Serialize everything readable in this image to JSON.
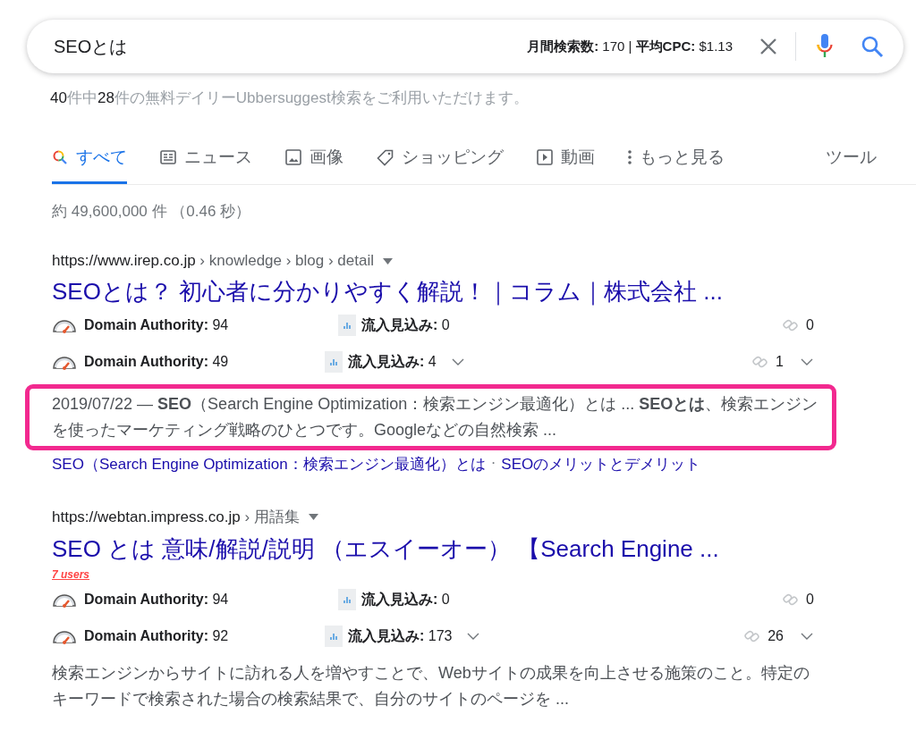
{
  "search": {
    "query": "SEOとは",
    "stats": "**月間検索数:** 170 | **平均CPC:** $1.13"
  },
  "quota": [
    {
      "text": "40",
      "emphasis": true
    },
    {
      "text": "件中",
      "emphasis": false
    },
    {
      "text": "28",
      "emphasis": true
    },
    {
      "text": "件の無料デイリーUbbersuggest検索をご利用いただけます。",
      "emphasis": false
    }
  ],
  "tabs": [
    {
      "label": "すべて",
      "kind": "search",
      "selected": true
    },
    {
      "label": "ニュース",
      "kind": "news",
      "selected": false
    },
    {
      "label": "画像",
      "kind": "image",
      "selected": false
    },
    {
      "label": "ショッピング",
      "kind": "tag",
      "selected": false
    },
    {
      "label": "動画",
      "kind": "video",
      "selected": false
    },
    {
      "label": "もっと見る",
      "kind": "more",
      "selected": false
    }
  ],
  "tools": "ツール",
  "result_count": "約 49,600,000 件 （0.46 秒）",
  "results": [
    {
      "url": "https://www.irep.co.jp",
      "breadcrumb": " › knowledge › blog › detail",
      "title": "SEOとは？ 初心者に分かりやすく解説！｜コラム｜株式会社 ...",
      "metrics": [
        {
          "da_label": "Domain Authority:",
          "da": "94",
          "traffic_label": "流入見込み:",
          "traffic": "0",
          "links": "0",
          "expandable": false
        },
        {
          "da_label": "Domain Authority:",
          "da": "49",
          "traffic_label": "流入見込み:",
          "traffic": "4",
          "links": "1",
          "expandable": true
        }
      ],
      "snippet": "2019/07/22 — **SEO**（Search Engine Optimization：検索エンジン最適化）とは ... **SEOとは**、検索エンジンを使ったマーケティング戦略のひとつです。Googleなどの自然検索 ...",
      "highlighted": true,
      "sitelinks": [
        "SEO（Search Engine Optimization：検索エンジン最適化）とは",
        "SEOのメリットとデメリット"
      ],
      "separator": "·"
    },
    {
      "url": "https://webtan.impress.co.jp",
      "breadcrumb": " › 用語集",
      "title": "SEO とは 意味/解説/説明 （エスイーオー） 【Search Engine ...",
      "badge": "7 users",
      "metrics": [
        {
          "da_label": "Domain Authority:",
          "da": "94",
          "traffic_label": "流入見込み:",
          "traffic": "0",
          "links": "0",
          "expandable": false
        },
        {
          "da_label": "Domain Authority:",
          "da": "92",
          "traffic_label": "流入見込み:",
          "traffic": "173",
          "links": "26",
          "expandable": true
        }
      ],
      "snippet": "検索エンジンからサイトに訪れる人を増やすことで、Webサイトの成果を向上させる施策のこと。特定のキーワードで検索された場合の検索結果で、自分のサイトのページを ...",
      "highlighted": false
    }
  ]
}
